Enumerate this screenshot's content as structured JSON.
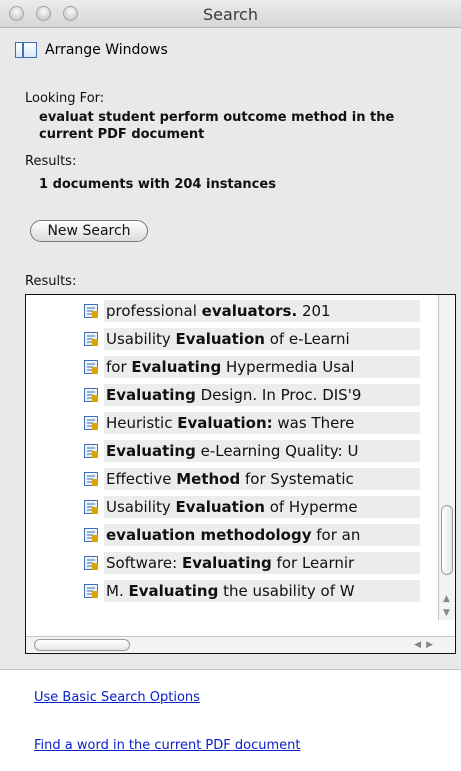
{
  "window": {
    "title": "Search"
  },
  "toolbar": {
    "arrange_label": "Arrange Windows"
  },
  "search": {
    "looking_for_label": "Looking For:",
    "query_line1": "evaluat student perform outcome method in the",
    "query_line2": "current PDF document",
    "results_label": "Results:",
    "results_summary": "1 documents with 204 instances",
    "new_search_label": "New Search",
    "results_list_label": "Results:"
  },
  "results": [
    {
      "pre": "professional ",
      "bold": "evaluators.",
      "post": " 201"
    },
    {
      "pre": "Usability ",
      "bold": "Evaluation",
      "post": " of e-Learni"
    },
    {
      "pre": "for ",
      "bold": "Evaluating",
      "post": " Hypermedia Usal"
    },
    {
      "pre": "",
      "bold": "Evaluating",
      "post": " Design. In Proc. DIS'9"
    },
    {
      "pre": "Heuristic ",
      "bold": "Evaluation:",
      "post": " was There"
    },
    {
      "pre": "",
      "bold": "Evaluating",
      "post": " e-Learning Quality: U"
    },
    {
      "pre": "Effective ",
      "bold": "Method",
      "post": " for Systematic"
    },
    {
      "pre": "Usability ",
      "bold": "Evaluation",
      "post": " of Hyperme"
    },
    {
      "pre": "",
      "bold": "evaluation methodology",
      "post": " for an"
    },
    {
      "pre": "Software: ",
      "bold": "Evaluating",
      "post": " for Learnir"
    },
    {
      "pre": "M. ",
      "bold": "Evaluating",
      "post": " the usability of W"
    }
  ],
  "footer": {
    "basic_options_link": "Use Basic Search Options",
    "find_word_link": "Find a word in the current PDF document"
  },
  "colors": {
    "link": "#0a22cc",
    "accent": "#3f6fb6",
    "result_icon": "#d9a400"
  }
}
